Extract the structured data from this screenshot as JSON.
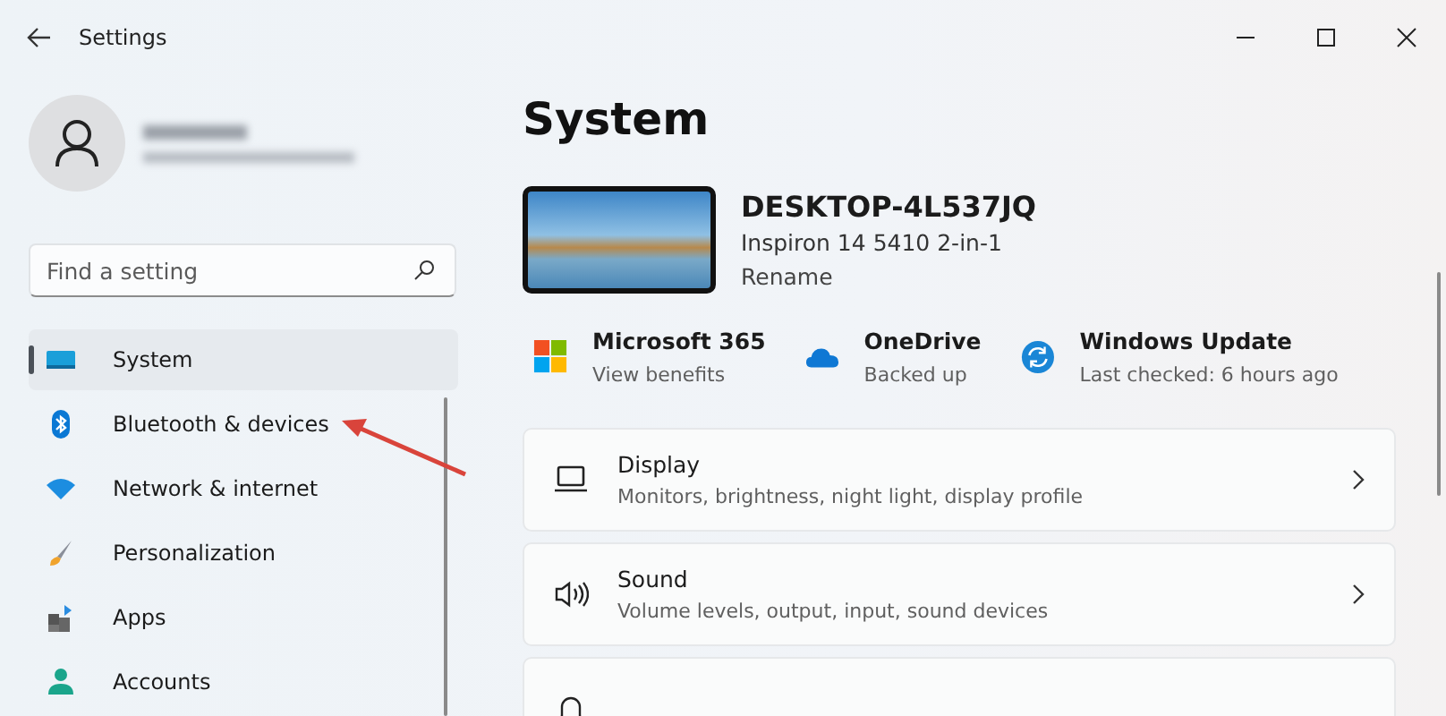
{
  "window": {
    "title": "Settings"
  },
  "search": {
    "placeholder": "Find a setting"
  },
  "sidebar": {
    "items": [
      {
        "label": "System",
        "kind": "system",
        "selected": true
      },
      {
        "label": "Bluetooth & devices",
        "kind": "bluetooth",
        "selected": false
      },
      {
        "label": "Network & internet",
        "kind": "network",
        "selected": false
      },
      {
        "label": "Personalization",
        "kind": "brush",
        "selected": false
      },
      {
        "label": "Apps",
        "kind": "apps",
        "selected": false
      },
      {
        "label": "Accounts",
        "kind": "accounts",
        "selected": false
      }
    ]
  },
  "page_title": "System",
  "device": {
    "name": "DESKTOP-4L537JQ",
    "model": "Inspiron 14 5410 2-in-1",
    "rename": "Rename"
  },
  "quick_links": [
    {
      "kind": "microsoft365",
      "title": "Microsoft 365",
      "subtitle": "View benefits"
    },
    {
      "kind": "onedrive",
      "title": "OneDrive",
      "subtitle": "Backed up"
    },
    {
      "kind": "update",
      "title": "Windows Update",
      "subtitle": "Last checked: 6 hours ago"
    }
  ],
  "cards": [
    {
      "kind": "display",
      "title": "Display",
      "description": "Monitors, brightness, night light, display profile"
    },
    {
      "kind": "sound",
      "title": "Sound",
      "description": "Volume levels, output, input, sound devices"
    },
    {
      "kind": "notifications"
    }
  ]
}
